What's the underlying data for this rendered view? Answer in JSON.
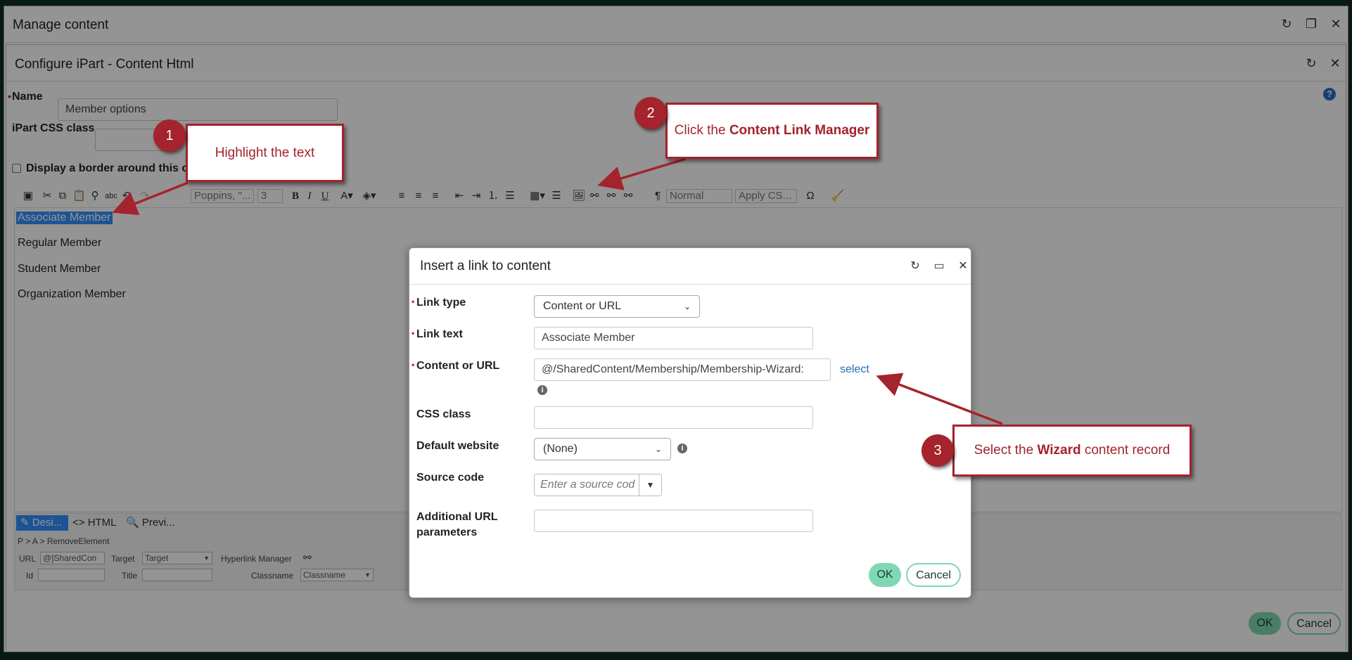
{
  "outer_window": {
    "title": "Manage content"
  },
  "inner_window": {
    "title": "Configure iPart - Content Html"
  },
  "form": {
    "name_label": "Name",
    "name_value": "Member options",
    "css_label": "iPart CSS class",
    "border_label": "Display a border around this c"
  },
  "toolbar": {
    "font_select": "Poppins, \"...",
    "size_select": "3",
    "format_select": "Normal",
    "css_select": "Apply CS...",
    "bold": "B",
    "italic": "I",
    "underline": "U",
    "omega": "Ω",
    "pilcrow": "¶"
  },
  "editor": {
    "lines": [
      "Associate Member",
      "Regular Member",
      "Student Member",
      "Organization Member"
    ]
  },
  "bottom": {
    "tabs": [
      "Desi...",
      "HTML",
      "Previ..."
    ],
    "breadcrumb_p": "P",
    "breadcrumb_a": "A",
    "breadcrumb_remove": "RemoveElement",
    "url_label": "URL",
    "url_value": "@]SharedCon",
    "target_label": "Target",
    "target_value": "Target",
    "hyperlink_label": "Hyperlink Manager",
    "id_label": "Id",
    "title_label": "Title",
    "classname_label": "Classname",
    "classname_value": "Classname",
    "ok": "OK",
    "cancel": "Cancel"
  },
  "dialog": {
    "title": "Insert a link to content",
    "link_type_label": "Link type",
    "link_type_value": "Content or URL",
    "link_text_label": "Link text",
    "link_text_value": "Associate Member",
    "content_url_label": "Content or URL",
    "content_url_value": "@/SharedContent/Membership/Membership-Wizard:",
    "select_link": "select",
    "css_class_label": "CSS class",
    "default_website_label": "Default website",
    "default_website_value": "(None)",
    "source_code_label": "Source code",
    "source_code_placeholder": "Enter a source cod",
    "additional_label_1": "Additional URL",
    "additional_label_2": "parameters",
    "ok": "OK",
    "cancel": "Cancel"
  },
  "callouts": [
    {
      "number": "1",
      "text": "Highlight the text",
      "prefix": "",
      "bold": "",
      "suffix": ""
    },
    {
      "number": "2",
      "prefix": "Click the ",
      "bold": "Content Link Manager",
      "suffix": ""
    },
    {
      "number": "3",
      "prefix": "Select the ",
      "bold": "Wizard",
      "suffix": " content record"
    }
  ],
  "colors": {
    "callout_red": "#a4232c",
    "accent_green": "#7fd8b4",
    "selection_blue": "#3390ff"
  }
}
